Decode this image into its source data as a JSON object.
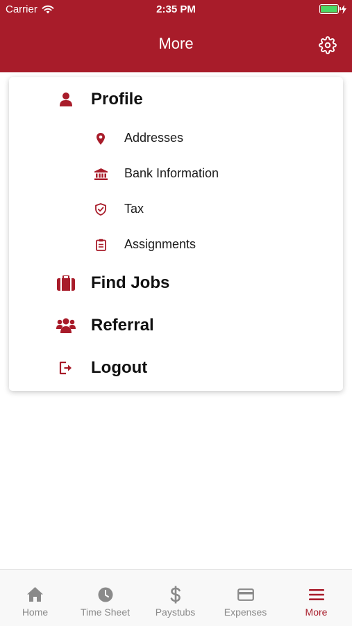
{
  "status_bar": {
    "carrier": "Carrier",
    "time": "2:35 PM"
  },
  "header": {
    "title": "More",
    "settings_icon": "gear-icon"
  },
  "colors": {
    "brand": "#a81c2a",
    "tab_inactive": "#8a8a8a",
    "battery": "#4cd964"
  },
  "menu": {
    "profile": {
      "label": "Profile",
      "icon": "user-icon"
    },
    "sub_items": [
      {
        "label": "Addresses",
        "icon": "map-pin-icon"
      },
      {
        "label": "Bank Information",
        "icon": "bank-icon"
      },
      {
        "label": "Tax",
        "icon": "shield-check-icon"
      },
      {
        "label": "Assignments",
        "icon": "clipboard-icon"
      }
    ],
    "find_jobs": {
      "label": "Find Jobs",
      "icon": "briefcase-icon"
    },
    "referral": {
      "label": "Referral",
      "icon": "users-icon"
    },
    "logout": {
      "label": "Logout",
      "icon": "logout-icon"
    }
  },
  "tabs": [
    {
      "label": "Home",
      "icon": "home-icon",
      "active": false
    },
    {
      "label": "Time Sheet",
      "icon": "clock-icon",
      "active": false
    },
    {
      "label": "Paystubs",
      "icon": "dollar-icon",
      "active": false
    },
    {
      "label": "Expenses",
      "icon": "credit-card-icon",
      "active": false
    },
    {
      "label": "More",
      "icon": "menu-icon",
      "active": true
    }
  ]
}
